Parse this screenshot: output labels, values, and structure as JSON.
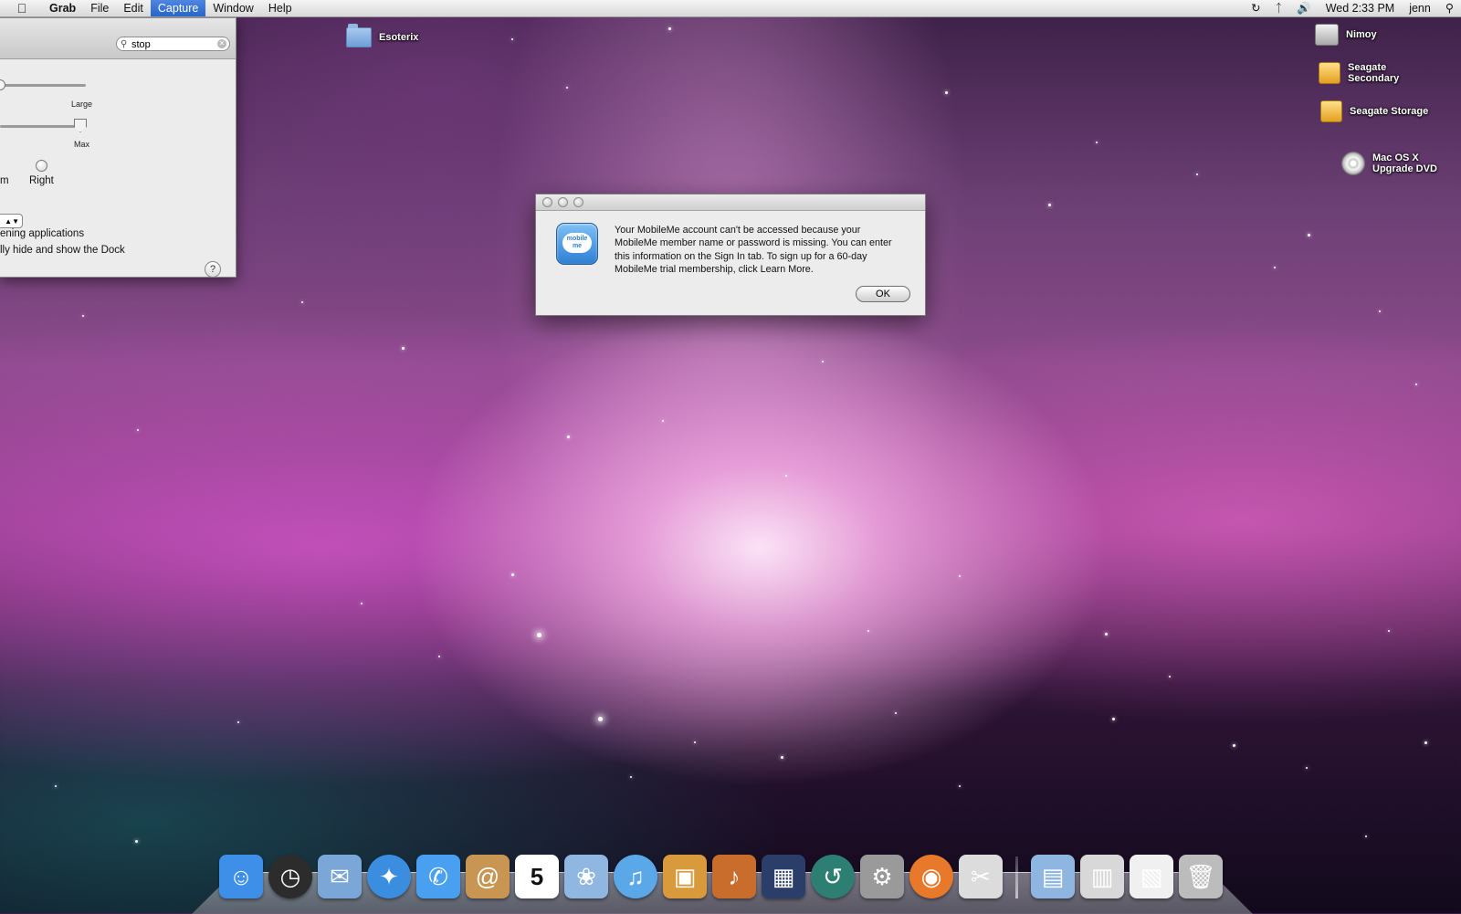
{
  "menubar": {
    "apple_icon": "apple-logo-icon",
    "app_name": "Grab",
    "menus": [
      "File",
      "Edit",
      "Capture",
      "Window",
      "Help"
    ],
    "active_menu": "Capture",
    "status": {
      "time_machine_icon": "time-machine-icon",
      "bluetooth_icon": "bluetooth-icon",
      "volume_icon": "volume-icon",
      "clock": "Wed 2:33 PM",
      "user": "jenn",
      "spotlight_icon": "spotlight-icon"
    }
  },
  "pref_window": {
    "search_value": "stop",
    "slider1_label": "Large",
    "slider2_label": "Max",
    "position_left_partial": "m",
    "position_right": "Right",
    "option1": "ening applications",
    "option2": "lly hide and show the Dock",
    "help_label": "?"
  },
  "dialog": {
    "message": "Your MobileMe account can't be accessed because your MobileMe member name or password is missing. You can enter this information on the Sign In tab. To sign up for a 60-day MobileMe trial membership, click Learn More.",
    "ok_label": "OK",
    "icon_text": "mobile me"
  },
  "desktop": {
    "folder": "Esoterix",
    "drives": [
      {
        "label": "Nimoy",
        "icon": "hard-drive-icon"
      },
      {
        "label": "Seagate Secondary",
        "icon": "external-drive-icon"
      },
      {
        "label": "Seagate Storage",
        "icon": "external-drive-icon"
      },
      {
        "label": "Mac OS X Upgrade DVD",
        "icon": "dvd-icon"
      }
    ]
  },
  "dock": {
    "apps": [
      {
        "name": "finder-icon",
        "glyph": "☺",
        "bg": "#3d8fe8"
      },
      {
        "name": "dashboard-icon",
        "glyph": "◷",
        "bg": "#2c2c2c"
      },
      {
        "name": "mail-icon",
        "glyph": "✉",
        "bg": "#7aa7d8"
      },
      {
        "name": "safari-icon",
        "glyph": "✦",
        "bg": "#3b8de0"
      },
      {
        "name": "ichat-icon",
        "glyph": "✆",
        "bg": "#4aa0f0"
      },
      {
        "name": "address-book-icon",
        "glyph": "@",
        "bg": "#c99552"
      },
      {
        "name": "ical-icon",
        "glyph": "5",
        "bg": "#ffffff"
      },
      {
        "name": "iphoto-icon",
        "glyph": "❀",
        "bg": "#8fb7e2"
      },
      {
        "name": "itunes-icon",
        "glyph": "♫",
        "bg": "#5aa8e8"
      },
      {
        "name": "image-capture-icon",
        "glyph": "▣",
        "bg": "#d99a3b"
      },
      {
        "name": "garageband-icon",
        "glyph": "♪",
        "bg": "#c86d2c"
      },
      {
        "name": "spaces-icon",
        "glyph": "▦",
        "bg": "#2b3e6a"
      },
      {
        "name": "time-machine-dock-icon",
        "glyph": "↺",
        "bg": "#2d7f73"
      },
      {
        "name": "system-preferences-icon",
        "glyph": "⚙",
        "bg": "#9a9a9a"
      },
      {
        "name": "firefox-icon",
        "glyph": "◉",
        "bg": "#e8792a"
      },
      {
        "name": "grab-icon",
        "glyph": "✂",
        "bg": "#dcdcdc"
      }
    ],
    "right_items": [
      {
        "name": "documents-stack-icon",
        "glyph": "▤",
        "bg": "#8eb6e0"
      },
      {
        "name": "downloads-stack-icon",
        "glyph": "▥",
        "bg": "#d8d8d8"
      },
      {
        "name": "web-document-icon",
        "glyph": "▧",
        "bg": "#f0f0f0"
      },
      {
        "name": "trash-icon",
        "glyph": "🗑",
        "bg": "#bcbcbc"
      }
    ]
  }
}
